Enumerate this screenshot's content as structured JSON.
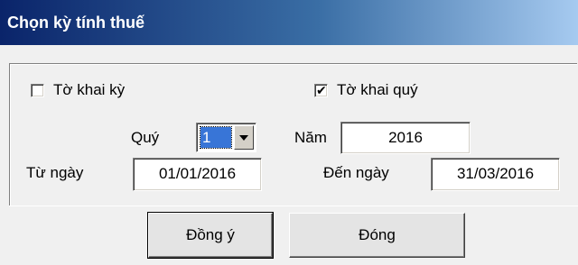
{
  "window": {
    "title": "Chọn kỳ tính thuế"
  },
  "options": {
    "monthly": {
      "label": "Tờ khai kỳ",
      "checked": false
    },
    "quarterly": {
      "label": "Tờ khai quý",
      "checked": true,
      "mark": "✔"
    }
  },
  "period": {
    "quarter_label": "Quý",
    "quarter_value": "1",
    "year_label": "Năm",
    "year_value": "2016",
    "from_label": "Từ ngày",
    "from_value": "01/01/2016",
    "to_label": "Đến ngày",
    "to_value": "31/03/2016"
  },
  "buttons": {
    "ok_label": "Đồng ý",
    "close_label": "Đóng"
  }
}
